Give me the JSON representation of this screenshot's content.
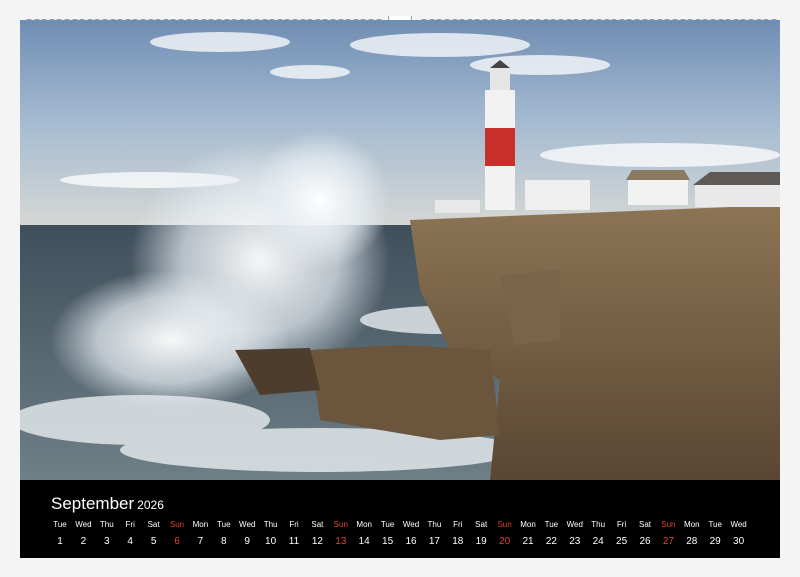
{
  "calendar": {
    "month": "September",
    "year": "2026",
    "days": [
      {
        "wd": "Tue",
        "n": "1"
      },
      {
        "wd": "Wed",
        "n": "2"
      },
      {
        "wd": "Thu",
        "n": "3"
      },
      {
        "wd": "Fri",
        "n": "4"
      },
      {
        "wd": "Sat",
        "n": "5"
      },
      {
        "wd": "Sun",
        "n": "6"
      },
      {
        "wd": "Mon",
        "n": "7"
      },
      {
        "wd": "Tue",
        "n": "8"
      },
      {
        "wd": "Wed",
        "n": "9"
      },
      {
        "wd": "Thu",
        "n": "10"
      },
      {
        "wd": "Fri",
        "n": "11"
      },
      {
        "wd": "Sat",
        "n": "12"
      },
      {
        "wd": "Sun",
        "n": "13"
      },
      {
        "wd": "Mon",
        "n": "14"
      },
      {
        "wd": "Tue",
        "n": "15"
      },
      {
        "wd": "Wed",
        "n": "16"
      },
      {
        "wd": "Thu",
        "n": "17"
      },
      {
        "wd": "Fri",
        "n": "18"
      },
      {
        "wd": "Sat",
        "n": "19"
      },
      {
        "wd": "Sun",
        "n": "20"
      },
      {
        "wd": "Mon",
        "n": "21"
      },
      {
        "wd": "Tue",
        "n": "22"
      },
      {
        "wd": "Wed",
        "n": "23"
      },
      {
        "wd": "Thu",
        "n": "24"
      },
      {
        "wd": "Fri",
        "n": "25"
      },
      {
        "wd": "Sat",
        "n": "26"
      },
      {
        "wd": "Sun",
        "n": "27"
      },
      {
        "wd": "Mon",
        "n": "28"
      },
      {
        "wd": "Tue",
        "n": "29"
      },
      {
        "wd": "Wed",
        "n": "30"
      }
    ]
  },
  "colors": {
    "calendar_background": "#000000",
    "weekday_text": "#ffffff",
    "sunday_text": "#e0452e",
    "lighthouse_band": "#c8312b"
  }
}
